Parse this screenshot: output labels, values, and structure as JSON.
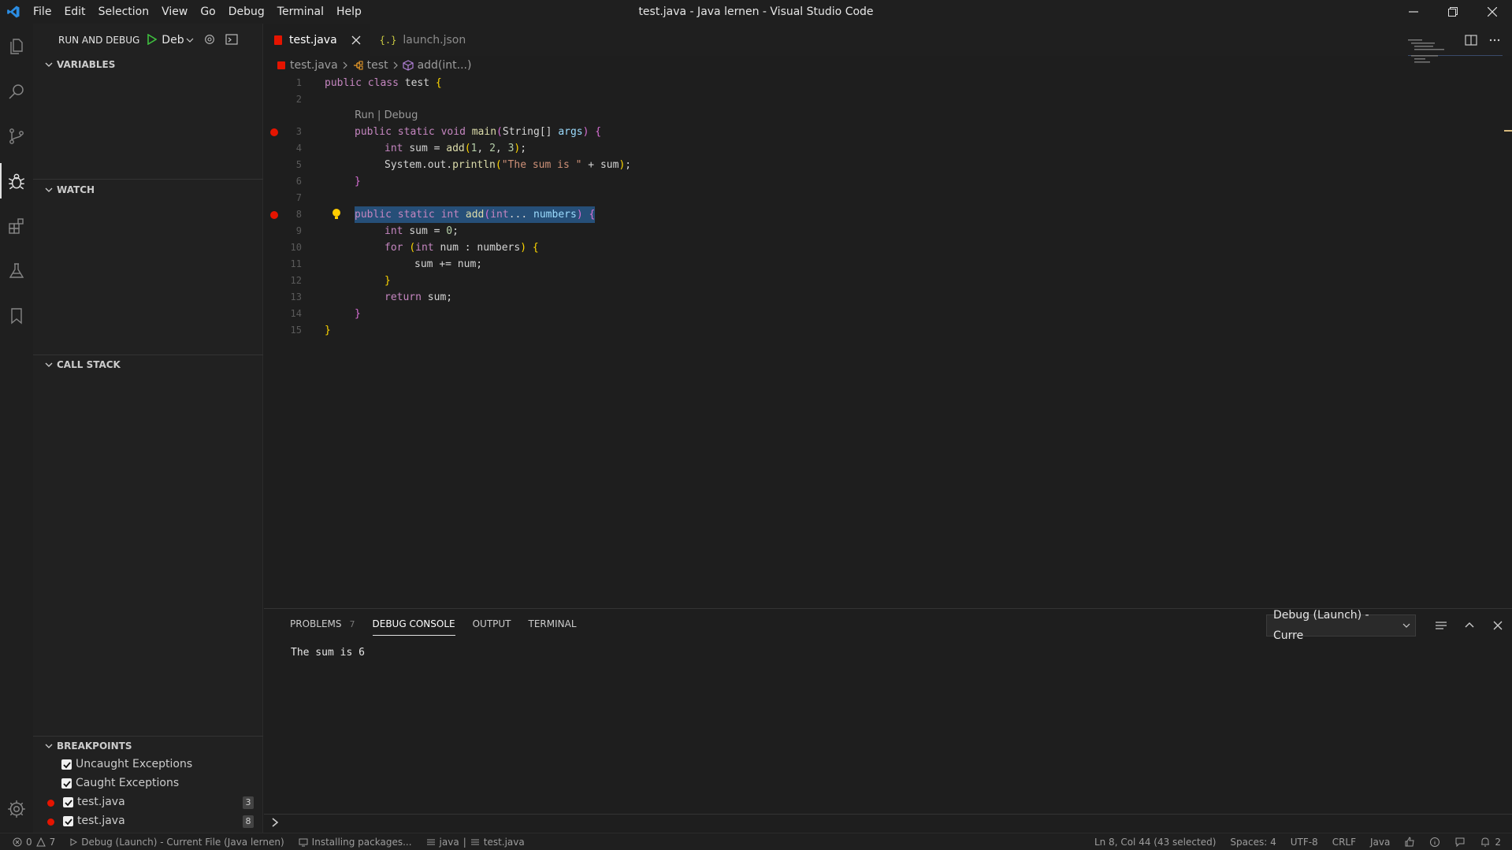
{
  "window": {
    "title": "test.java - Java lernen - Visual Studio Code",
    "menu": [
      "File",
      "Edit",
      "Selection",
      "View",
      "Go",
      "Debug",
      "Terminal",
      "Help"
    ]
  },
  "sidebar": {
    "header": "RUN AND DEBUG",
    "config": "Deb",
    "sections": {
      "variables": "VARIABLES",
      "watch": "WATCH",
      "call_stack": "CALL STACK",
      "breakpoints": "BREAKPOINTS"
    },
    "breakpoints": [
      {
        "label": "Uncaught Exceptions",
        "badge": ""
      },
      {
        "label": "Caught Exceptions",
        "badge": ""
      },
      {
        "label": "test.java",
        "badge": "3"
      },
      {
        "label": "test.java",
        "badge": "8"
      }
    ]
  },
  "editor": {
    "tabs": [
      {
        "label": "test.java",
        "icon": "java-file-icon"
      },
      {
        "label": "launch.json",
        "icon": "json-file-icon"
      }
    ],
    "breadcrumb": [
      "test.java",
      "test",
      "add(int...)"
    ],
    "codelens": "Run | Debug",
    "line_numbers": [
      "1",
      "2",
      "3",
      "4",
      "5",
      "6",
      "7",
      "8",
      "9",
      "10",
      "11",
      "12",
      "13",
      "14",
      "15"
    ]
  },
  "panel": {
    "tabs": [
      "PROBLEMS",
      "DEBUG CONSOLE",
      "OUTPUT",
      "TERMINAL"
    ],
    "problems_count": "7",
    "select": "Debug (Launch) - Curre",
    "output": "The sum is 6"
  },
  "status": {
    "errors": "0",
    "warnings": "7",
    "debug": "Debug (Launch) - Current File (Java lernen)",
    "installing": "Installing packages...",
    "java": "java",
    "file": "test.java",
    "position": "Ln 8, Col 44 (43 selected)",
    "spaces": "Spaces: 4",
    "encoding": "UTF-8",
    "eol": "CRLF",
    "language": "Java",
    "notifications": "2"
  },
  "colors": {
    "accent": "#e51400",
    "background": "#1e1e1e",
    "bracket": "#ffd700"
  }
}
